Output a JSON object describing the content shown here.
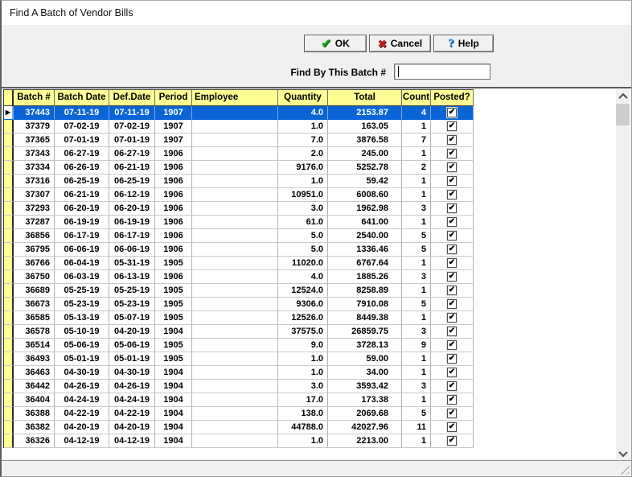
{
  "window": {
    "title": "Find A Batch of Vendor Bills"
  },
  "buttons": {
    "ok": "OK",
    "cancel": "Cancel",
    "help": "Help"
  },
  "icons": {
    "ok": "✔",
    "cancel": "✖",
    "help": "?",
    "row_indicator": "▶",
    "checkbox_check": "✔"
  },
  "search": {
    "label": "Find By This Batch #",
    "value": ""
  },
  "grid": {
    "columns": [
      "Batch #",
      "Batch Date",
      "Def.Date",
      "Period",
      "Employee",
      "Quantity",
      "Total",
      "Count",
      "Posted?"
    ],
    "selected_row_index": 0,
    "rows": [
      {
        "batch": "37443",
        "batch_date": "07-11-19",
        "def_date": "07-11-19",
        "period": "1907",
        "employee": "",
        "quantity": "4.0",
        "total": "2153.87",
        "count": "4",
        "posted": true
      },
      {
        "batch": "37379",
        "batch_date": "07-02-19",
        "def_date": "07-02-19",
        "period": "1907",
        "employee": "",
        "quantity": "1.0",
        "total": "163.05",
        "count": "1",
        "posted": true
      },
      {
        "batch": "37365",
        "batch_date": "07-01-19",
        "def_date": "07-01-19",
        "period": "1907",
        "employee": "",
        "quantity": "7.0",
        "total": "3876.58",
        "count": "7",
        "posted": true
      },
      {
        "batch": "37343",
        "batch_date": "06-27-19",
        "def_date": "06-27-19",
        "period": "1906",
        "employee": "",
        "quantity": "2.0",
        "total": "245.00",
        "count": "1",
        "posted": true
      },
      {
        "batch": "37334",
        "batch_date": "06-26-19",
        "def_date": "06-21-19",
        "period": "1906",
        "employee": "",
        "quantity": "9176.0",
        "total": "5252.78",
        "count": "2",
        "posted": true
      },
      {
        "batch": "37316",
        "batch_date": "06-25-19",
        "def_date": "06-25-19",
        "period": "1906",
        "employee": "",
        "quantity": "1.0",
        "total": "59.42",
        "count": "1",
        "posted": true
      },
      {
        "batch": "37307",
        "batch_date": "06-21-19",
        "def_date": "06-12-19",
        "period": "1906",
        "employee": "",
        "quantity": "10951.0",
        "total": "6008.60",
        "count": "1",
        "posted": true
      },
      {
        "batch": "37293",
        "batch_date": "06-20-19",
        "def_date": "06-20-19",
        "period": "1906",
        "employee": "",
        "quantity": "3.0",
        "total": "1962.98",
        "count": "3",
        "posted": true
      },
      {
        "batch": "37287",
        "batch_date": "06-19-19",
        "def_date": "06-19-19",
        "period": "1906",
        "employee": "",
        "quantity": "61.0",
        "total": "641.00",
        "count": "1",
        "posted": true
      },
      {
        "batch": "36856",
        "batch_date": "06-17-19",
        "def_date": "06-17-19",
        "period": "1906",
        "employee": "",
        "quantity": "5.0",
        "total": "2540.00",
        "count": "5",
        "posted": true
      },
      {
        "batch": "36795",
        "batch_date": "06-06-19",
        "def_date": "06-06-19",
        "period": "1906",
        "employee": "",
        "quantity": "5.0",
        "total": "1336.46",
        "count": "5",
        "posted": true
      },
      {
        "batch": "36766",
        "batch_date": "06-04-19",
        "def_date": "05-31-19",
        "period": "1905",
        "employee": "",
        "quantity": "11020.0",
        "total": "6767.64",
        "count": "1",
        "posted": true
      },
      {
        "batch": "36750",
        "batch_date": "06-03-19",
        "def_date": "06-13-19",
        "period": "1906",
        "employee": "",
        "quantity": "4.0",
        "total": "1885.26",
        "count": "3",
        "posted": true
      },
      {
        "batch": "36689",
        "batch_date": "05-25-19",
        "def_date": "05-25-19",
        "period": "1905",
        "employee": "",
        "quantity": "12524.0",
        "total": "8258.89",
        "count": "1",
        "posted": true
      },
      {
        "batch": "36673",
        "batch_date": "05-23-19",
        "def_date": "05-23-19",
        "period": "1905",
        "employee": "",
        "quantity": "9306.0",
        "total": "7910.08",
        "count": "5",
        "posted": true
      },
      {
        "batch": "36585",
        "batch_date": "05-13-19",
        "def_date": "05-07-19",
        "period": "1905",
        "employee": "",
        "quantity": "12526.0",
        "total": "8449.38",
        "count": "1",
        "posted": true
      },
      {
        "batch": "36578",
        "batch_date": "05-10-19",
        "def_date": "04-20-19",
        "period": "1904",
        "employee": "",
        "quantity": "37575.0",
        "total": "26859.75",
        "count": "3",
        "posted": true
      },
      {
        "batch": "36514",
        "batch_date": "05-06-19",
        "def_date": "05-06-19",
        "period": "1905",
        "employee": "",
        "quantity": "9.0",
        "total": "3728.13",
        "count": "9",
        "posted": true
      },
      {
        "batch": "36493",
        "batch_date": "05-01-19",
        "def_date": "05-01-19",
        "period": "1905",
        "employee": "",
        "quantity": "1.0",
        "total": "59.00",
        "count": "1",
        "posted": true
      },
      {
        "batch": "36463",
        "batch_date": "04-30-19",
        "def_date": "04-30-19",
        "period": "1904",
        "employee": "",
        "quantity": "1.0",
        "total": "34.00",
        "count": "1",
        "posted": true
      },
      {
        "batch": "36442",
        "batch_date": "04-26-19",
        "def_date": "04-26-19",
        "period": "1904",
        "employee": "",
        "quantity": "3.0",
        "total": "3593.42",
        "count": "3",
        "posted": true
      },
      {
        "batch": "36404",
        "batch_date": "04-24-19",
        "def_date": "04-24-19",
        "period": "1904",
        "employee": "",
        "quantity": "17.0",
        "total": "173.38",
        "count": "1",
        "posted": true
      },
      {
        "batch": "36388",
        "batch_date": "04-22-19",
        "def_date": "04-22-19",
        "period": "1904",
        "employee": "",
        "quantity": "138.0",
        "total": "2069.68",
        "count": "5",
        "posted": true
      },
      {
        "batch": "36382",
        "batch_date": "04-20-19",
        "def_date": "04-20-19",
        "period": "1904",
        "employee": "",
        "quantity": "44788.0",
        "total": "42027.96",
        "count": "11",
        "posted": true
      },
      {
        "batch": "36326",
        "batch_date": "04-12-19",
        "def_date": "04-12-19",
        "period": "1904",
        "employee": "",
        "quantity": "1.0",
        "total": "2213.00",
        "count": "1",
        "posted": true
      }
    ]
  },
  "colors": {
    "header_bg": "#ffff94",
    "selection_bg": "#0a64d6",
    "selection_text": "#ffffff",
    "panel_bg": "#f0f0f0",
    "ok_icon": "#1ca51c",
    "cancel_icon": "#b71f1f",
    "help_icon": "#2387d6"
  }
}
